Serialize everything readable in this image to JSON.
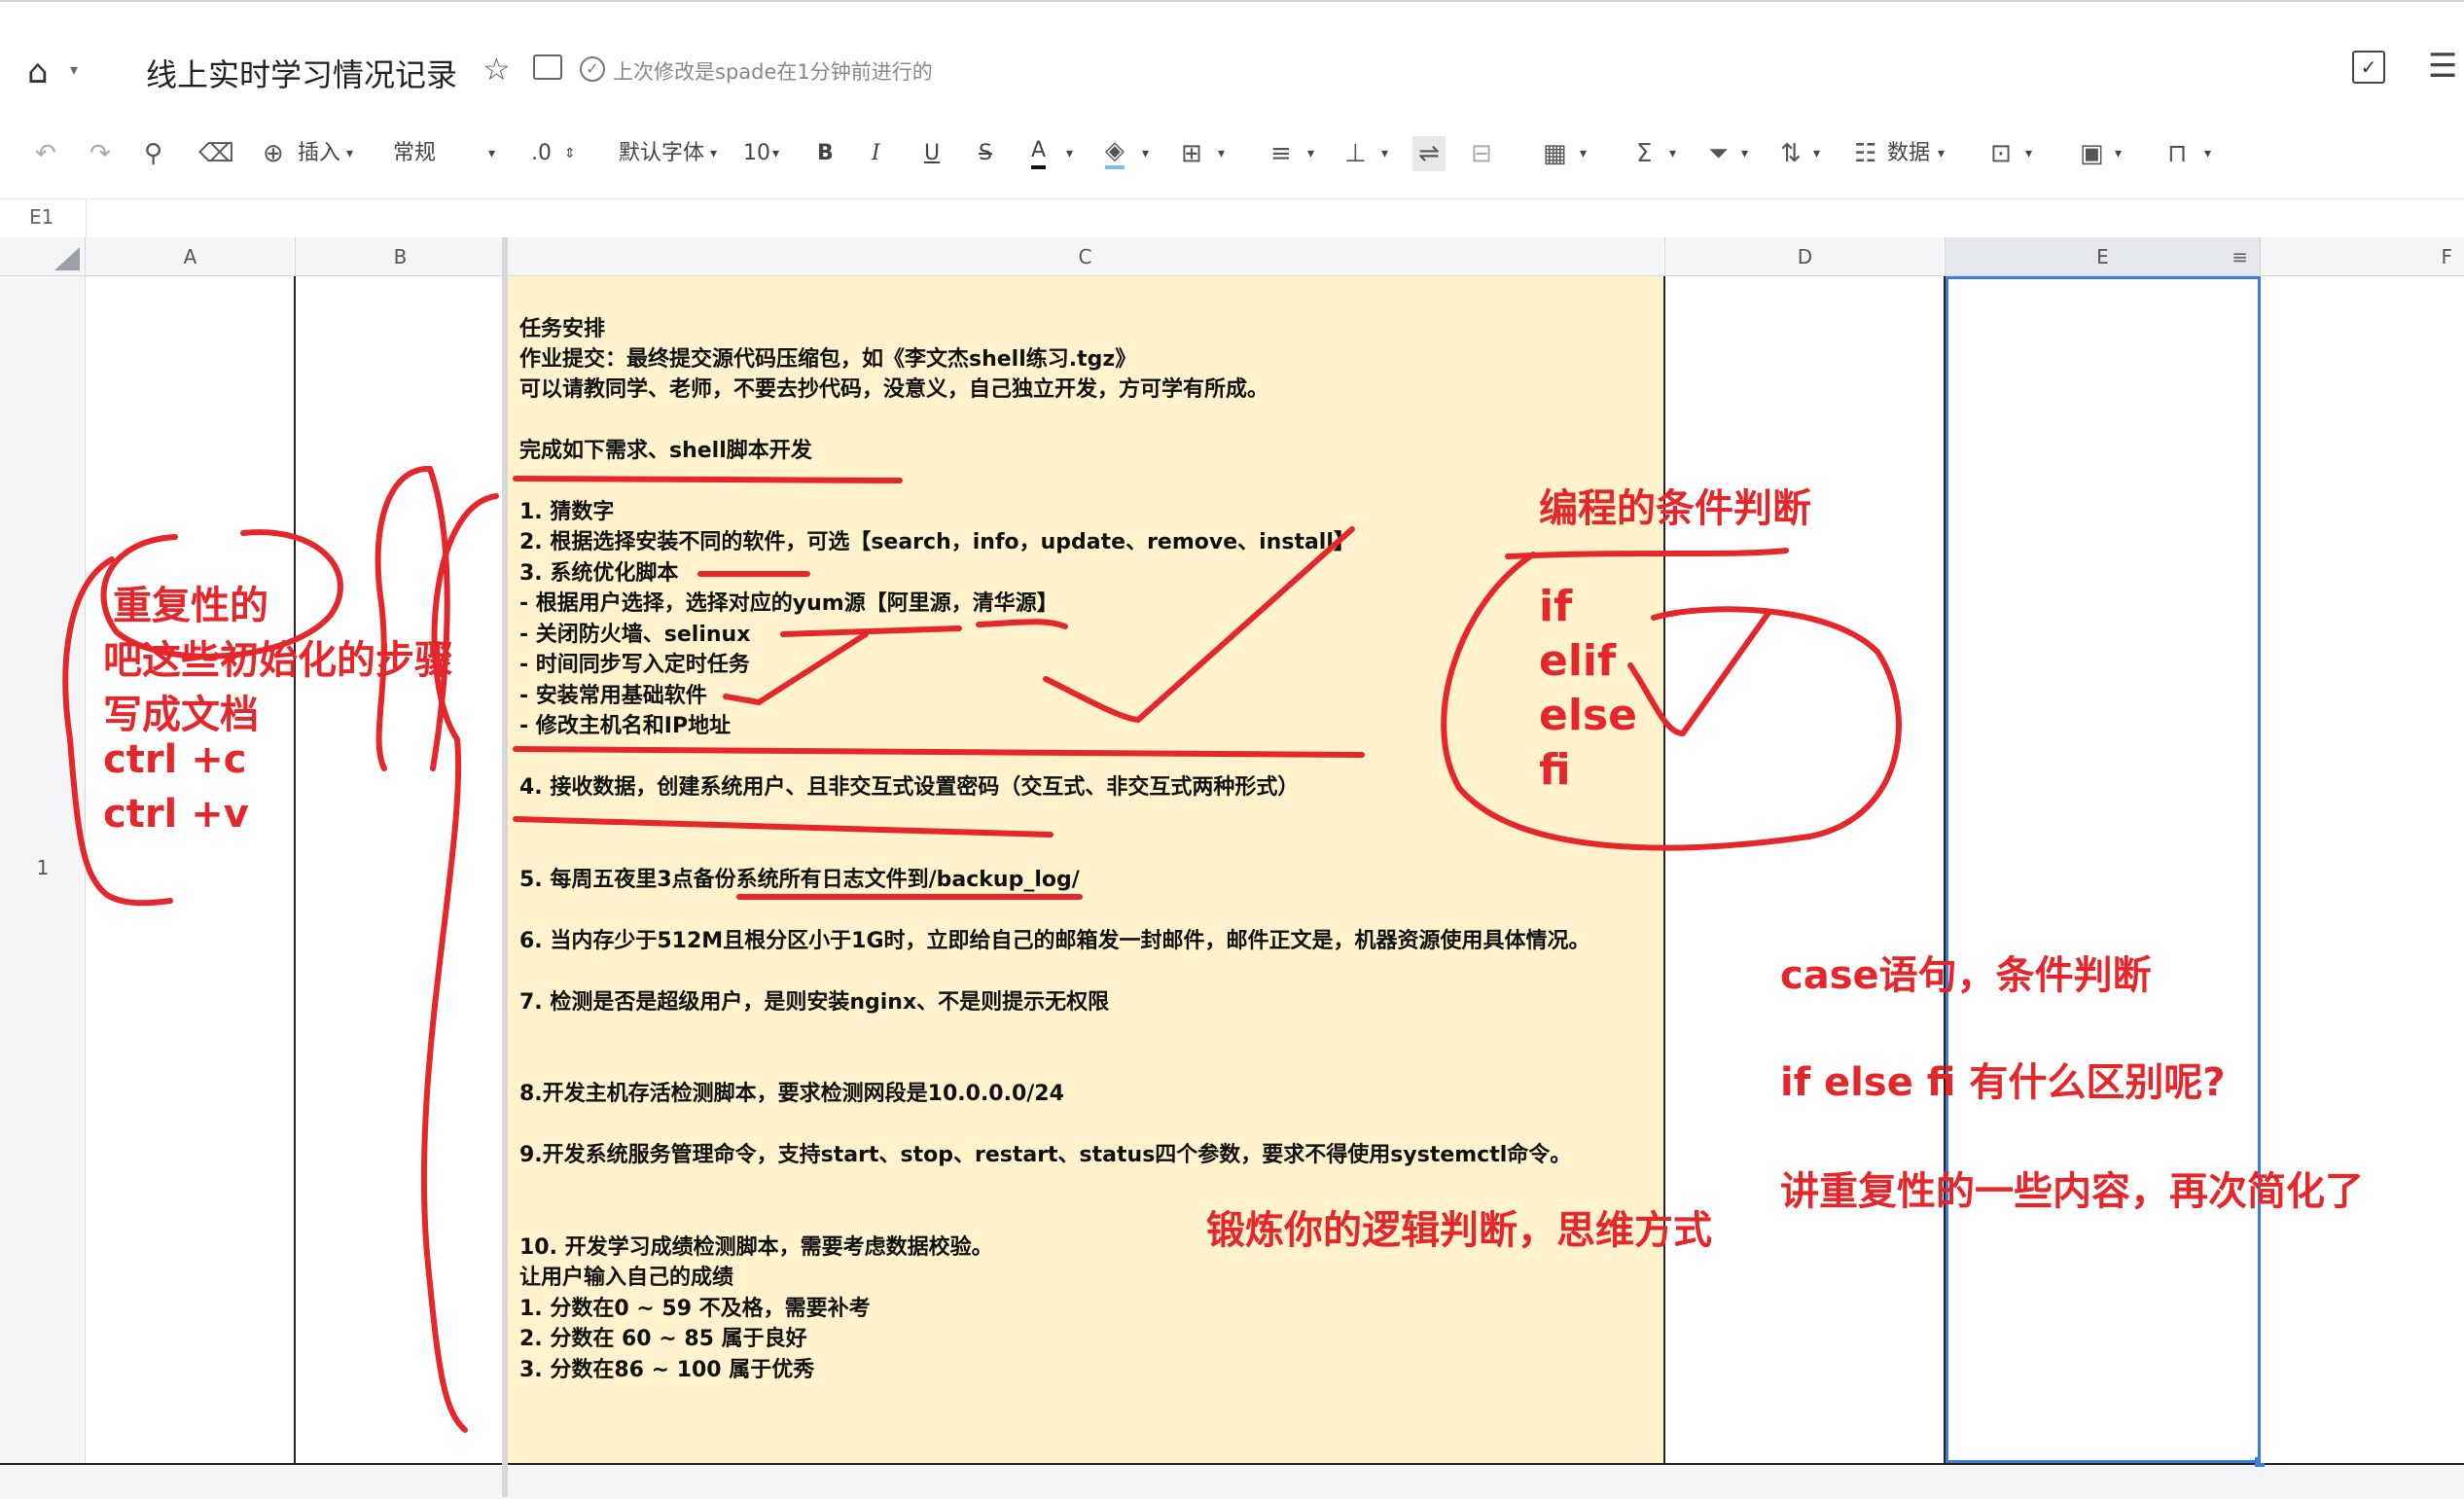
{
  "header": {
    "doc_title": "线上实时学习情况记录",
    "save_status": "上次修改是spade在1分钟前进行的"
  },
  "toolbar": {
    "insert_label": "插入",
    "format_value": "常规",
    "decimal_value": ".0",
    "font_family": "默认字体",
    "font_size": "10",
    "bold": "B",
    "italic": "I",
    "underline": "U",
    "strike": "S",
    "font_color_glyph": "A",
    "data_label": "数据"
  },
  "formula_bar": {
    "cell_ref": "E1"
  },
  "columns": [
    "A",
    "B",
    "C",
    "D",
    "E",
    "F"
  ],
  "row_number": "1",
  "cell_c1_lines": [
    "",
    "任务安排",
    "作业提交：最终提交源代码压缩包，如《李文杰shell练习.tgz》",
    "可以请教同学、老师，不要去抄代码，没意义，自己独立开发，方可学有所成。",
    "",
    "完成如下需求、shell脚本开发",
    "",
    "1. 猜数字",
    "2. 根据选择安装不同的软件，可选【search，info，update、remove、install】",
    "3. 系统优化脚本",
    "- 根据用户选择，选择对应的yum源【阿里源，清华源】",
    "- 关闭防火墙、selinux",
    "- 时间同步写入定时任务",
    "- 安装常用基础软件",
    "- 修改主机名和IP地址",
    "",
    "4. 接收数据，创建系统用户、且非交互式设置密码（交互式、非交互式两种形式）",
    "",
    "",
    "5. 每周五夜里3点备份系统所有日志文件到/backup_log/",
    "",
    "6. 当内存少于512M且根分区小于1G时，立即给自己的邮箱发一封邮件，邮件正文是，机器资源使用具体情况。",
    "",
    "7. 检测是否是超级用户，是则安装nginx、不是则提示无权限",
    "",
    "",
    "8.开发主机存活检测脚本，要求检测网段是10.0.0.0/24",
    "",
    "9.开发系统服务管理命令，支持start、stop、restart、status四个参数，要求不得使用systemctl命令。",
    "",
    "",
    "10. 开发学习成绩检测脚本，需要考虑数据校验。",
    "让用户输入自己的成绩",
    "1. 分数在0 ~ 59 不及格，需要补考",
    "2. 分数在 60 ~ 85 属于良好",
    "3. 分数在86 ~ 100 属于优秀"
  ],
  "annotations": {
    "left_notes": [
      "重复性的",
      "吧这些初始化的步骤",
      "写成文档",
      "ctrl +c",
      "ctrl +v"
    ],
    "cond_title": "编程的条件判断",
    "keywords": [
      "if",
      "elif",
      "else",
      "fi"
    ],
    "logic_note": "锻炼你的逻辑判断，思维方式",
    "case_note": "case语句，条件判断",
    "diff_note": "if else fi 有什么区别呢?",
    "simplify_note": "讲重复性的一些内容，再次简化了"
  },
  "colors": {
    "highlight_fill": "#fff2cc",
    "annotation_red": "#e5262a",
    "selection_blue": "#3b7ddd"
  }
}
